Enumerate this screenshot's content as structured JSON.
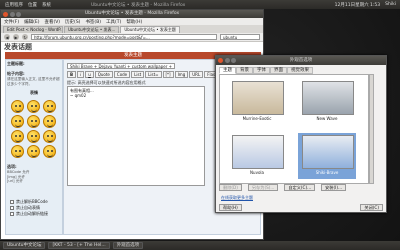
{
  "top_panel": {
    "menus": [
      "应用程序",
      "位置",
      "系统"
    ],
    "window_title": "Ubuntu中文论坛 • 发表主题 - Mozilla Firefox",
    "clock": "12月11日星期六 1:53",
    "user": "Shiki"
  },
  "firefox": {
    "title": "Ubuntu中文论坛 • 发表主题 - Mozilla Firefox",
    "menu": [
      "文件(F)",
      "编辑(E)",
      "查看(V)",
      "历史(S)",
      "书签(B)",
      "工具(T)",
      "帮助(H)"
    ],
    "tabs": [
      "Edit Post < Noclog - WordP...",
      "Ubuntu中文论坛 • 发表...",
      "Ubuntu中文论坛 • 发表主题"
    ],
    "url": "http://forum.ubuntu.org.cn/posting.php?mode=post&f=...",
    "search_placeholder": "ubuntu"
  },
  "page": {
    "title": "发表话题",
    "form_header": "发表主题",
    "left": {
      "subject_label": "主题标题:",
      "message_label": "帖子内容:",
      "message_hint": "请在这里输入正文, 这里不允许超过多少个字符。",
      "smileys_label": "表情",
      "options_label": "选项:",
      "bbcode": "BBCode 允许",
      "img": "[img] 允许",
      "url": "[url] 允许"
    },
    "font_select": "Shiki Brave + Dejavu Yuanti + custom wallpaper + ",
    "font_label": "字体大小:",
    "font_value": "正常",
    "toolbar": [
      "B",
      "i",
      "u",
      "Quote",
      "Code",
      "List",
      "List=",
      "[*]",
      "Img",
      "URL",
      "Flash"
    ],
    "hint": "提示: 高亮选择可以快速对所选内容应用格式",
    "message": "有图有真相...\n~ qm02",
    "options": [
      "禁止解析BBCode",
      "禁止自动表情",
      "禁止自动解析链接"
    ]
  },
  "dialog": {
    "title": "外观首选项",
    "tabs": [
      "主题",
      "背景",
      "字体",
      "界面",
      "视觉效果"
    ],
    "themes": [
      {
        "name": "Murrine-Exotic",
        "selected": false
      },
      {
        "name": "New Wave",
        "selected": false
      },
      {
        "name": "Nuvola",
        "selected": false
      },
      {
        "name": "Shiki-Brave",
        "selected": true
      }
    ],
    "delete_btn": "删除(D)",
    "save_btn": "另存为(S)...",
    "custom_btn": "自定义(C)...",
    "install_btn": "安装(I)...",
    "more_link": "在线获取更多主题",
    "help_btn": "帮助(H)",
    "close_btn": "关闭(C)"
  },
  "bottom_panel": {
    "tasks": [
      "Ubuntu中文论坛",
      "[KKT - 53 - [+ The Hel...",
      "外观首选项"
    ]
  },
  "colors": {
    "form_header": "#b8482b",
    "selected_theme": "#7aa3d8",
    "close_button": "#e0552c"
  }
}
